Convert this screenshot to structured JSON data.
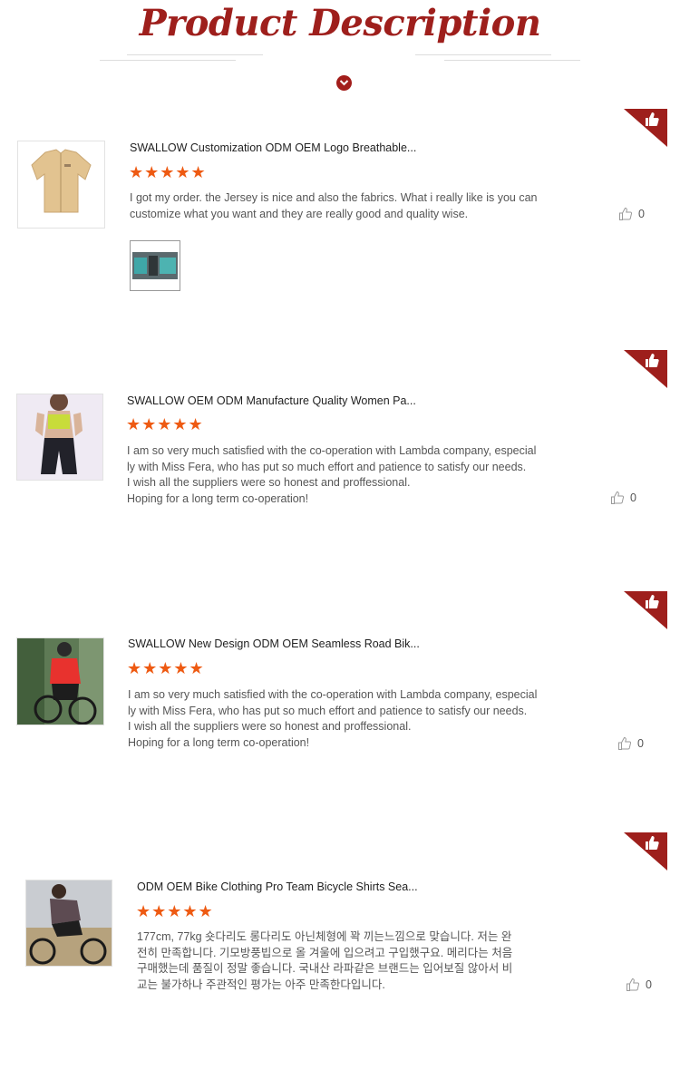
{
  "header": {
    "title": "Product Description"
  },
  "reviews": [
    {
      "product": "SWALLOW Customization ODM OEM Logo Breathable...",
      "stars": "★★★★★",
      "rating": 5,
      "lines": [
        "I got my order. the Jersey is nice and also the fabrics. What i really like is you can",
        "customize what you want and they are really good and quality wise."
      ],
      "likes": "0",
      "has_attachment": true
    },
    {
      "product": "SWALLOW OEM ODM Manufacture Quality Women Pa...",
      "stars": "★★★★★",
      "rating": 5,
      "lines": [
        "I am so very much satisfied with the co-operation with Lambda company, especial",
        "ly with Miss Fera, who has put so much effort and patience to satisfy our needs.",
        "I wish all the suppliers were so honest and proffessional.",
        "Hoping for a long term co-operation!"
      ],
      "likes": "0"
    },
    {
      "product": "SWALLOW New Design ODM OEM Seamless Road Bik...",
      "stars": "★★★★★",
      "rating": 5,
      "lines": [
        "I am so very much satisfied with the co-operation with Lambda company, especial",
        "ly with Miss Fera, who has put so much effort and patience to satisfy our needs.",
        "I wish all the suppliers were so honest and proffessional.",
        "Hoping for a long term co-operation!"
      ],
      "likes": "0"
    },
    {
      "product": "ODM OEM Bike Clothing Pro Team Bicycle Shirts Sea...",
      "stars": "★★★★★",
      "rating": 5,
      "lines": [
        "177cm, 77kg 숏다리도 롱다리도 아닌체형에 꽉 끼는느낌으로 맞습니다. 저는 완",
        "전히 만족합니다. 기모방풍빕으로 올 겨울에 입으려고 구입했구요. 메리다는 처음",
        "구매했는데 품질이 정말 좋습니다. 국내산 라파같은 브랜드는 입어보질 않아서 비",
        "교는 불가하나 주관적인 평가는 아주 만족한다입니다."
      ],
      "likes": "0"
    }
  ],
  "colors": {
    "accent": "#9e1f1c",
    "star": "#ee5a12"
  }
}
